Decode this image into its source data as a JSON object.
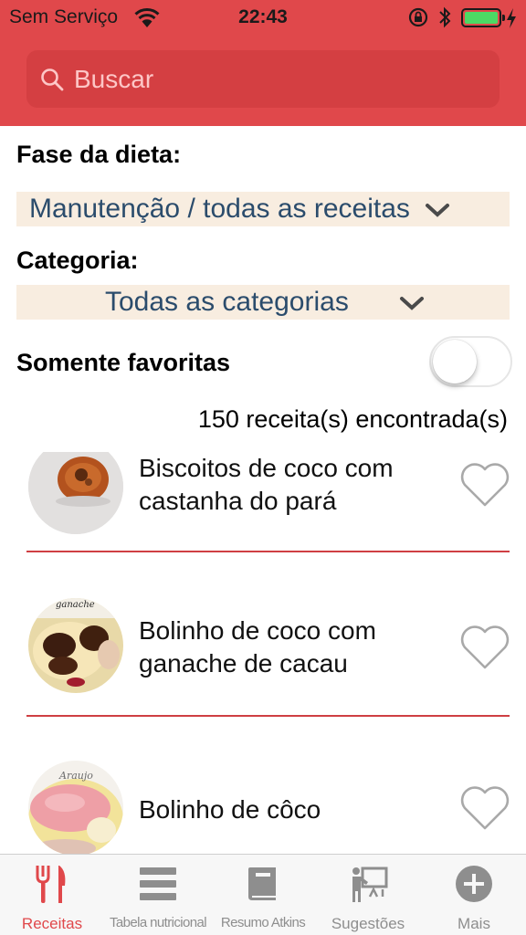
{
  "status_bar": {
    "carrier": "Sem Serviço",
    "time": "22:43",
    "battery_color": "#4cd964"
  },
  "search": {
    "placeholder": "Buscar",
    "value": ""
  },
  "filters": {
    "diet_phase_label": "Fase da dieta:",
    "diet_phase_value": "Manutenção / todas as receitas",
    "category_label": "Categoria:",
    "category_value": "Todas as categorias",
    "favorites_label": "Somente favoritas",
    "favorites_on": false
  },
  "result_count": "150 receita(s) encontrada(s)",
  "recipes": [
    {
      "title": "Biscoitos de coco com castanha do pará",
      "photo": "coconut-cookie-photo",
      "favorite": false
    },
    {
      "title": "Bolinho de coco com ganache de cacau",
      "photo": "cake-ganache-photo",
      "photo_caption": "ganache",
      "favorite": false
    },
    {
      "title": "Bolinho de côco",
      "photo": "coconut-cake-photo",
      "photo_caption": "Araujo",
      "favorite": false
    }
  ],
  "tabs": [
    {
      "label": "Receitas",
      "icon": "fork-knife-icon",
      "active": true
    },
    {
      "label": "Tabela nutricional",
      "icon": "list-icon",
      "active": false
    },
    {
      "label": "Resumo Atkins",
      "icon": "book-icon",
      "active": false
    },
    {
      "label": "Sugestões",
      "icon": "presentation-icon",
      "active": false
    },
    {
      "label": "Mais",
      "icon": "plus-circle-icon",
      "active": false
    }
  ],
  "colors": {
    "brand_red": "#e0484b",
    "picker_bg": "#f8ede0",
    "picker_text": "#2b4c6c",
    "tab_inactive": "#8e8e8e"
  }
}
